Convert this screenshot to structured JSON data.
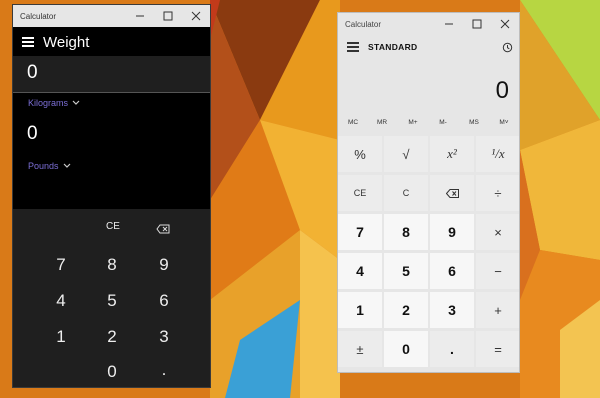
{
  "converter": {
    "window_title": "Calculator",
    "mode": "Weight",
    "input_value": "0",
    "from_unit": "Kilograms",
    "output_value": "0",
    "to_unit": "Pounds",
    "keys": [
      "CE",
      "7",
      "8",
      "9",
      "4",
      "5",
      "6",
      "1",
      "2",
      "3",
      "0",
      "."
    ]
  },
  "standard": {
    "window_title": "Calculator",
    "mode": "STANDARD",
    "display": "0",
    "memory": [
      "MC",
      "MR",
      "M+",
      "M-",
      "MS",
      "M˅"
    ],
    "row1": [
      "%",
      "√",
      "x²",
      "¹/x"
    ],
    "row2": [
      "CE",
      "C",
      "⌫",
      "÷"
    ],
    "row3": [
      "7",
      "8",
      "9",
      "×"
    ],
    "row4": [
      "4",
      "5",
      "6",
      "−"
    ],
    "row5": [
      "1",
      "2",
      "3",
      "+"
    ],
    "row6": [
      "±",
      "0",
      ".",
      "="
    ]
  },
  "colors": {
    "accent": "#7c6fd6",
    "dark_bg": "#000000",
    "light_bg": "#e6e6e6"
  },
  "icons": [
    "menu-icon",
    "chevron-down-icon",
    "backspace-icon",
    "history-icon",
    "minimize-icon",
    "maximize-icon",
    "close-icon"
  ]
}
